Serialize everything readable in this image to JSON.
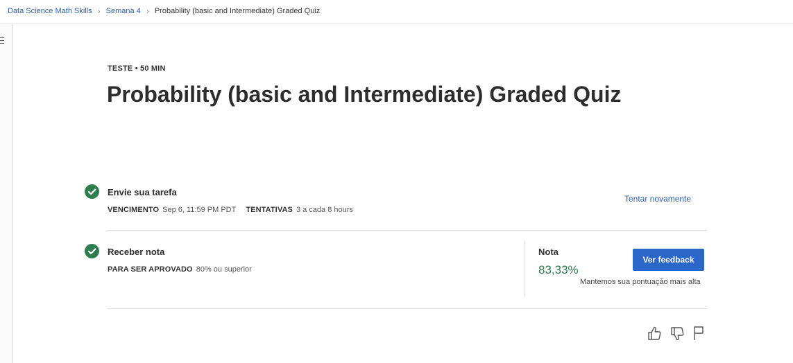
{
  "breadcrumb": {
    "course": "Data Science Math Skills",
    "week": "Semana 4",
    "current": "Probability (basic and Intermediate) Graded Quiz"
  },
  "header": {
    "kicker": "TESTE • 50 MIN",
    "title": "Probability (basic and Intermediate) Graded Quiz"
  },
  "submit": {
    "title": "Envie sua tarefa",
    "due_label": "VENCIMENTO",
    "due_value": "Sep 6, 11:59 PM PDT",
    "attempts_label": "TENTATIVAS",
    "attempts_value": "3 a cada 8 hours",
    "retry_label": "Tentar novamente"
  },
  "grade": {
    "title": "Receber nota",
    "pass_label": "PARA SER APROVADO",
    "pass_value": "80% ou superior",
    "grade_label": "Nota",
    "grade_value": "83,33%",
    "note": "Mantemos sua pontuação mais alta",
    "feedback_button": "Ver feedback"
  },
  "icons": [
    "menu-icon",
    "chevron-right-icon",
    "check-circle-icon",
    "thumbs-up-icon",
    "thumbs-down-icon",
    "flag-icon"
  ],
  "colors": {
    "link": "#2a5ea8",
    "success": "#2e7d4f",
    "button": "#2a67c9"
  }
}
